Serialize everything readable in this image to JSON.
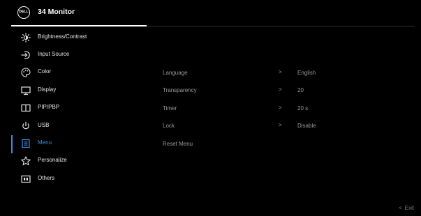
{
  "header": {
    "logo_text": "DELL",
    "title": "34 Monitor"
  },
  "menu": {
    "items": [
      {
        "label": "Brightness/Contrast",
        "icon": "brightness-icon"
      },
      {
        "label": "Input Source",
        "icon": "input-source-icon"
      },
      {
        "label": "Color",
        "icon": "color-icon"
      },
      {
        "label": "Display",
        "icon": "display-icon"
      },
      {
        "label": "PIP/PBP",
        "icon": "pip-pbp-icon"
      },
      {
        "label": "USB",
        "icon": "usb-icon"
      },
      {
        "label": "Menu",
        "icon": "menu-icon",
        "active": true
      },
      {
        "label": "Personalize",
        "icon": "star-icon"
      },
      {
        "label": "Others",
        "icon": "others-icon"
      }
    ]
  },
  "submenu": {
    "rows": [
      {
        "label": "Language",
        "chevron": ">",
        "value": "English"
      },
      {
        "label": "Transparency",
        "chevron": ">",
        "value": "20"
      },
      {
        "label": "Timer",
        "chevron": ">",
        "value": "20 s"
      },
      {
        "label": "Lock",
        "chevron": ">",
        "value": "Disable"
      },
      {
        "label": "Reset Menu"
      }
    ]
  },
  "footer": {
    "exit_chevron": "<",
    "exit_label": "Exit"
  },
  "colors": {
    "accent": "#3d8ee0",
    "background": "#000000",
    "text": "#e6e6e6",
    "muted": "#9a9a9a"
  }
}
